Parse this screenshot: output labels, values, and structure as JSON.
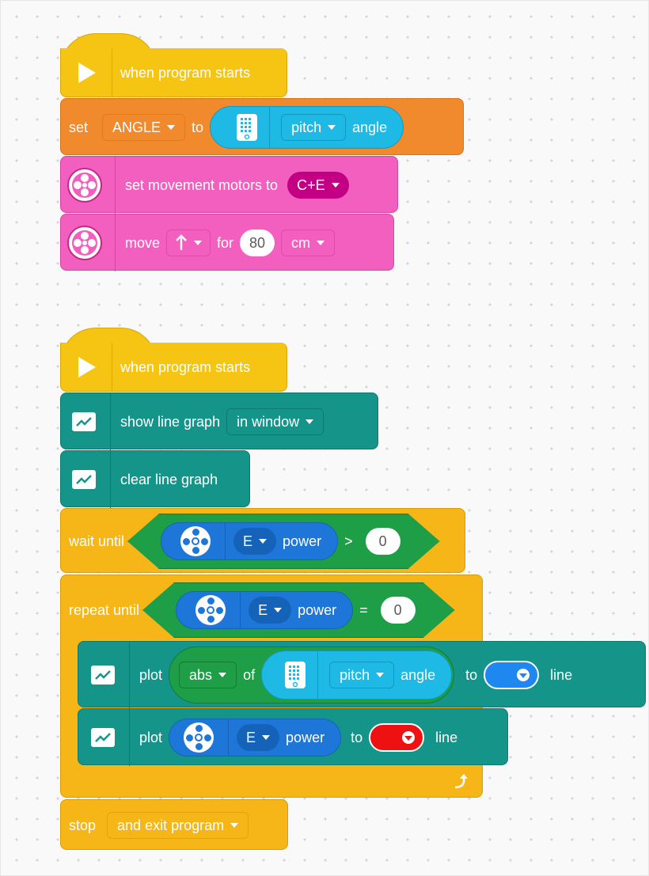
{
  "colors": {
    "events": "#f6c413",
    "variables": "#f1892d",
    "motor": "#f35fbf",
    "motor_pill": "#c30083",
    "linegraph": "#15958a",
    "control": "#f6b618",
    "sensor": "#1fb9e6",
    "operator": "#1f9e48",
    "motor_reporter": "#1e77d8",
    "line_blue": "#1e87f0",
    "line_red": "#ee1111"
  },
  "stack1": {
    "hat": {
      "label": "when program starts",
      "icon": "play-icon"
    },
    "set": {
      "label": "set",
      "variable": "ANGLE",
      "to": "to",
      "sensor_icon": "hub-sensor-icon",
      "axis": "pitch",
      "unit": "angle"
    },
    "motors": {
      "icon": "movement-motor-icon",
      "label": "set movement motors to",
      "pair": "C+E"
    },
    "move": {
      "icon": "movement-motor-icon",
      "label": "move",
      "direction_icon": "up-arrow-icon",
      "for": "for",
      "amount": "80",
      "unit": "cm"
    }
  },
  "stack2": {
    "hat": {
      "label": "when program starts",
      "icon": "play-icon"
    },
    "show": {
      "icon": "line-graph-icon",
      "label": "show line graph",
      "mode": "in window"
    },
    "clear": {
      "icon": "line-graph-icon",
      "label": "clear line graph"
    },
    "wait": {
      "label": "wait until",
      "motor_icon": "motor-icon",
      "port": "E",
      "measure": "power",
      "op": ">",
      "value": "0"
    },
    "repeat": {
      "label": "repeat until",
      "motor_icon": "motor-icon",
      "port": "E",
      "measure": "power",
      "op": "=",
      "value": "0",
      "loop_icon": "loop-arrow-icon"
    },
    "plot1": {
      "icon": "line-graph-icon",
      "label": "plot",
      "fn": "abs",
      "of": "of",
      "sensor_icon": "hub-sensor-icon",
      "axis": "pitch",
      "unit": "angle",
      "to": "to",
      "line_color": "blue",
      "line": "line"
    },
    "plot2": {
      "icon": "line-graph-icon",
      "label": "plot",
      "motor_icon": "motor-icon",
      "port": "E",
      "measure": "power",
      "to": "to",
      "line_color": "red",
      "line": "line"
    },
    "stop": {
      "label": "stop",
      "mode": "and exit program"
    }
  }
}
